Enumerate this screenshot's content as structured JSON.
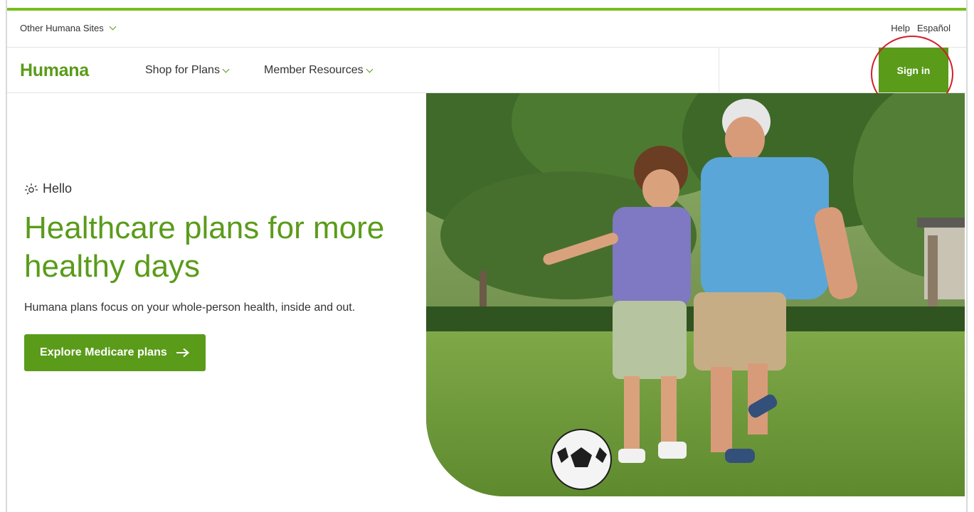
{
  "utility": {
    "other_sites": "Other Humana Sites",
    "help": "Help",
    "espanol": "Español"
  },
  "nav": {
    "logo": "Humana",
    "shop": "Shop for Plans",
    "member": "Member Resources",
    "signin": "Sign in"
  },
  "hero": {
    "greeting": "Hello",
    "headline": "Healthcare plans for more healthy days",
    "subcopy": "Humana plans focus on your whole-person health, inside and out.",
    "cta": "Explore Medicare plans"
  },
  "colors": {
    "brand_green": "#5a9b1a",
    "accent_green": "#78be20",
    "annotation_red": "#d41e2b"
  },
  "icons": [
    "chevron-down-icon",
    "sun-icon",
    "arrow-right-icon"
  ]
}
